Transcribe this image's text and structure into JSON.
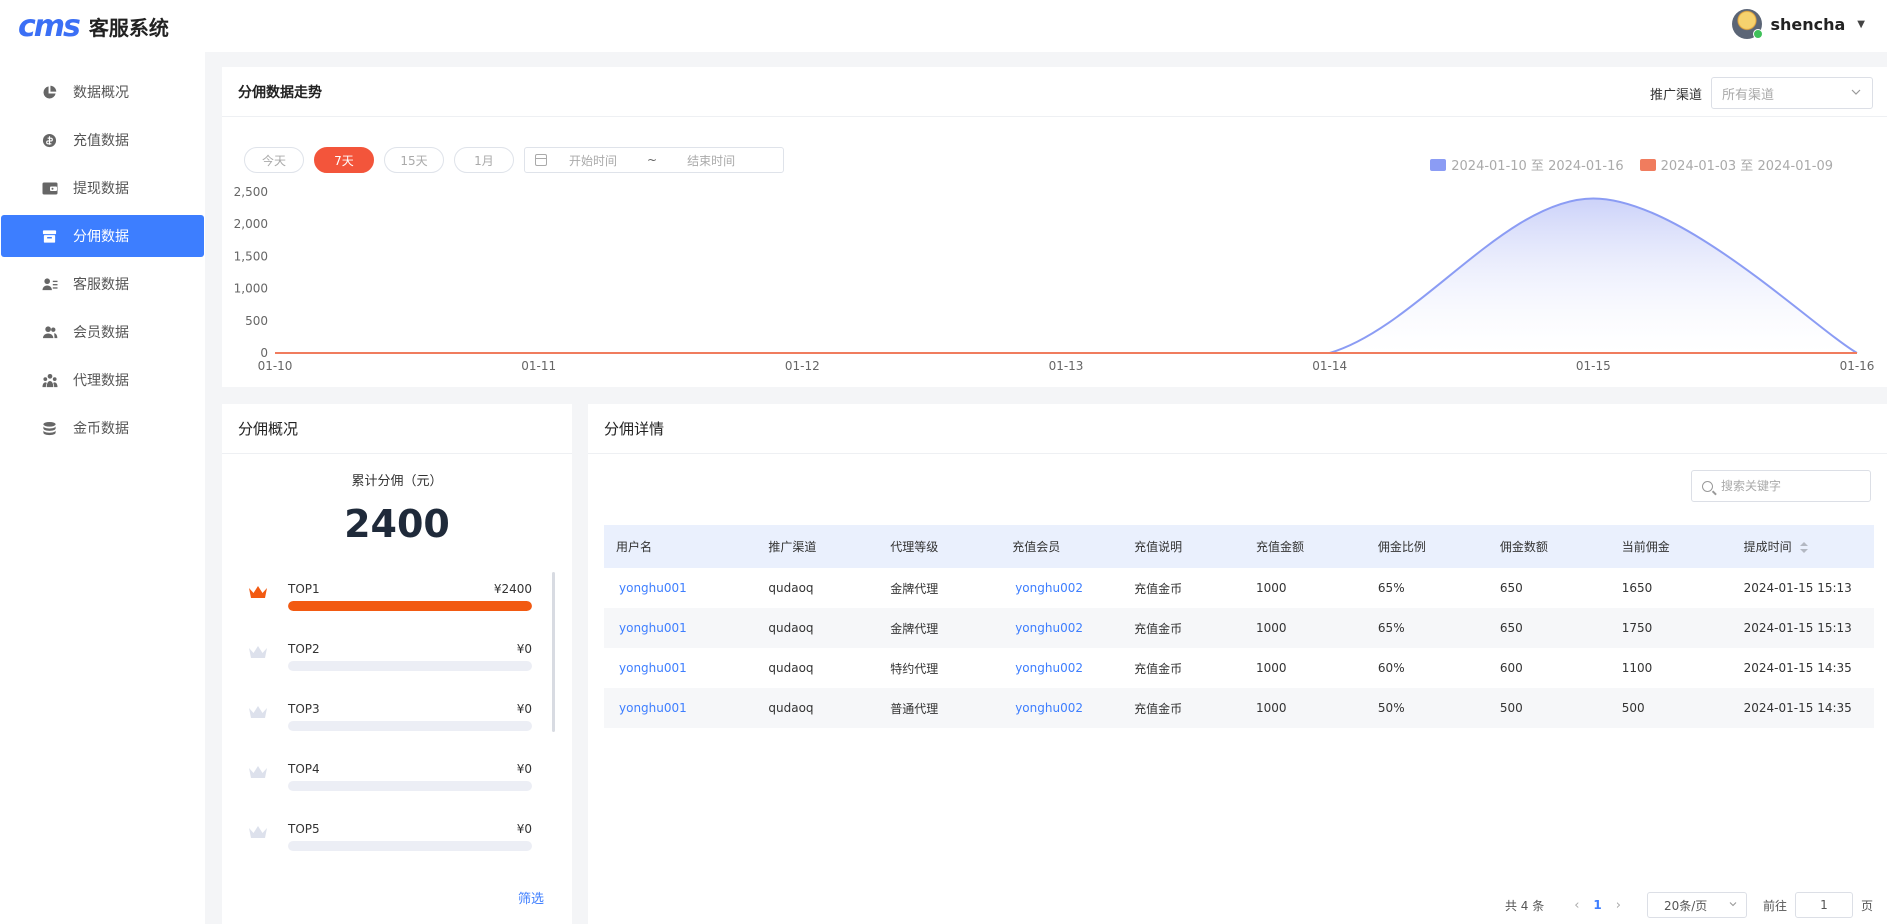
{
  "app": {
    "logo_mark": "cms",
    "title": "客服系统"
  },
  "user": {
    "name": "shencha"
  },
  "sidebar": {
    "items": [
      {
        "label": "数据概况",
        "icon": "pie-chart-icon"
      },
      {
        "label": "充值数据",
        "icon": "coin-icon"
      },
      {
        "label": "提现数据",
        "icon": "wallet-icon"
      },
      {
        "label": "分佣数据",
        "icon": "archive-icon",
        "active": true
      },
      {
        "label": "客服数据",
        "icon": "agent-list-icon"
      },
      {
        "label": "会员数据",
        "icon": "members-icon"
      },
      {
        "label": "代理数据",
        "icon": "proxy-icon"
      },
      {
        "label": "金币数据",
        "icon": "coins-stack-icon"
      }
    ]
  },
  "trend": {
    "title": "分佣数据走势",
    "channel_label": "推广渠道",
    "channel_placeholder": "所有渠道",
    "ranges": [
      "今天",
      "7天",
      "15天",
      "1月"
    ],
    "active_range": "7天",
    "date_start_placeholder": "开始时间",
    "date_sep": "~",
    "date_end_placeholder": "结束时间"
  },
  "chart_data": {
    "type": "area",
    "x": [
      "01-10",
      "01-11",
      "01-12",
      "01-13",
      "01-14",
      "01-15",
      "01-16"
    ],
    "ylim": [
      0,
      2500
    ],
    "yticks": [
      "0",
      "500",
      "1,000",
      "1,500",
      "2,000",
      "2,500"
    ],
    "grid": false,
    "legend_position": "top-right",
    "series": [
      {
        "name": "2024-01-10 至 2024-01-16",
        "color": "#8b9cf4",
        "values": [
          0,
          0,
          0,
          0,
          0,
          2400,
          0
        ]
      },
      {
        "name": "2024-01-03 至 2024-01-09",
        "color": "#f07c5e",
        "values": [
          0,
          0,
          0,
          0,
          0,
          0,
          0
        ]
      }
    ]
  },
  "overview": {
    "title": "分佣概况",
    "total_label": "累计分佣（元）",
    "total_value": "2400",
    "ranks": [
      {
        "name": "TOP1",
        "amount": "¥2400",
        "fraction": 1.0
      },
      {
        "name": "TOP2",
        "amount": "¥0",
        "fraction": 0
      },
      {
        "name": "TOP3",
        "amount": "¥0",
        "fraction": 0
      },
      {
        "name": "TOP4",
        "amount": "¥0",
        "fraction": 0
      },
      {
        "name": "TOP5",
        "amount": "¥0",
        "fraction": 0
      }
    ],
    "filter_label": "筛选"
  },
  "details": {
    "title": "分佣详情",
    "search_placeholder": "搜索关键字",
    "columns": [
      "用户名",
      "推广渠道",
      "代理等级",
      "充值会员",
      "充值说明",
      "充值金额",
      "佣金比例",
      "佣金数额",
      "当前佣金",
      "提成时间"
    ],
    "rows": [
      [
        "yonghu001",
        "qudaoq",
        "金牌代理",
        "yonghu002",
        "充值金币",
        "1000",
        "65%",
        "650",
        "1650",
        "2024-01-15 15:13"
      ],
      [
        "yonghu001",
        "qudaoq",
        "金牌代理",
        "yonghu002",
        "充值金币",
        "1000",
        "65%",
        "650",
        "1750",
        "2024-01-15 15:13"
      ],
      [
        "yonghu001",
        "qudaoq",
        "特约代理",
        "yonghu002",
        "充值金币",
        "1000",
        "60%",
        "600",
        "1100",
        "2024-01-15 14:35"
      ],
      [
        "yonghu001",
        "qudaoq",
        "普通代理",
        "yonghu002",
        "充值金币",
        "1000",
        "50%",
        "500",
        "500",
        "2024-01-15 14:35"
      ]
    ],
    "pager": {
      "total": "共 4 条",
      "current_page": "1",
      "page_size": "20条/页",
      "goto_label": "前往",
      "goto_value": "1",
      "page_suffix": "页"
    }
  }
}
